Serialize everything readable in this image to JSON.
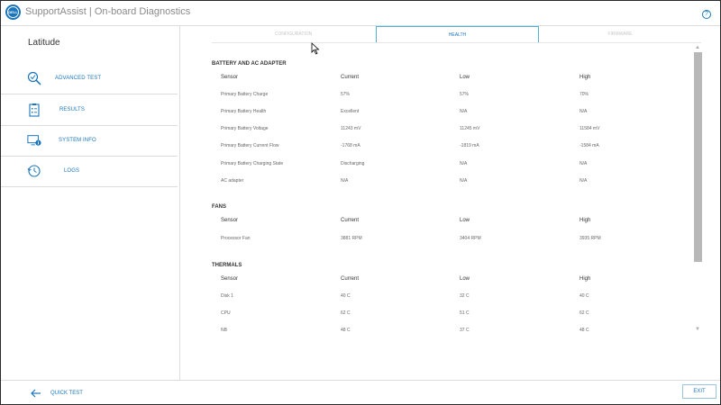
{
  "app": {
    "title": "SupportAssist | On-board Diagnostics",
    "logo_text": "DELL"
  },
  "colors": {
    "accent": "#1b75bb",
    "tab_border": "#4fb3d7",
    "scrollbar": "#b8b8b8"
  },
  "sidebar": {
    "device_name": "Latitude",
    "items": [
      {
        "label": "ADVANCED TEST",
        "icon": "magnifier-check-icon"
      },
      {
        "label": "RESULTS",
        "icon": "clipboard-list-icon"
      },
      {
        "label": "SYSTEM INFO",
        "icon": "monitor-info-icon"
      },
      {
        "label": "LOGS",
        "icon": "clock-history-icon"
      }
    ]
  },
  "tabs": [
    {
      "label": "CONFIGURATION",
      "active": false
    },
    {
      "label": "HEALTH",
      "active": true
    },
    {
      "label": "FIRMWARE",
      "active": false
    }
  ],
  "health": {
    "battery": {
      "title": "BATTERY AND AC ADAPTER",
      "headers": [
        "Sensor",
        "Current",
        "Low",
        "High"
      ],
      "rows": [
        [
          "Primary Battery Charge",
          "57%",
          "57%",
          "70%"
        ],
        [
          "Primary Battery Health",
          "Excellent",
          "N/A",
          "N/A"
        ],
        [
          "Primary Battery Voltage",
          "11243 mV",
          "11245 mV",
          "11584 mV"
        ],
        [
          "Primary Battery Current Flow",
          "-1768 mA",
          "-1819 mA",
          "-1584 mA"
        ],
        [
          "Primary Battery Charging State",
          "Discharging",
          "N/A",
          "N/A"
        ],
        [
          "AC adapter",
          "N/A",
          "N/A",
          "N/A"
        ]
      ]
    },
    "fans": {
      "title": "FANS",
      "headers": [
        "Sensor",
        "Current",
        "Low",
        "High"
      ],
      "rows": [
        [
          "Processor Fan",
          "3881 RPM",
          "3404 RPM",
          "3935 RPM"
        ]
      ]
    },
    "thermals": {
      "title": "THERMALS",
      "headers": [
        "Sensor",
        "Current",
        "Low",
        "High"
      ],
      "rows": [
        [
          "Disk 1",
          "40 C",
          "32 C",
          "40 C"
        ],
        [
          "CPU",
          "62 C",
          "51 C",
          "62 C"
        ],
        [
          "NB",
          "48 C",
          "37 C",
          "48 C"
        ]
      ]
    }
  },
  "footer": {
    "quick_test_label": "QUICK TEST",
    "exit_label": "EXIT"
  }
}
